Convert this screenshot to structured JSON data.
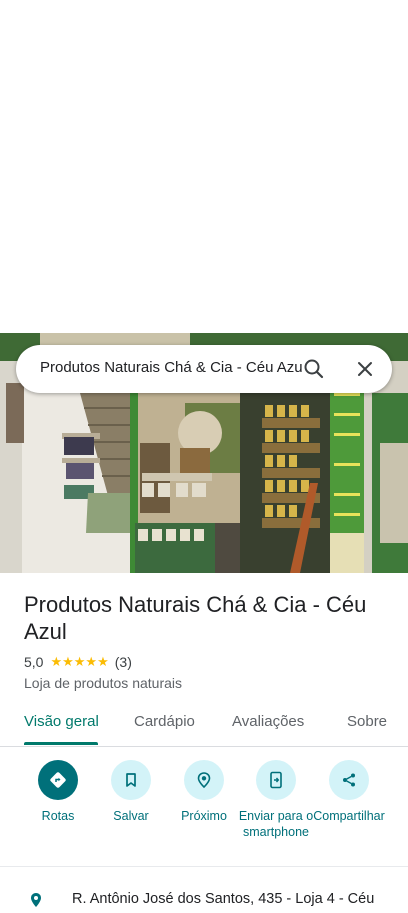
{
  "search": {
    "query": "Produtos Naturais Chá & Cia - Céu Azul"
  },
  "place": {
    "name": "Produtos Naturais Chá & Cia - Céu Azul",
    "rating": "5,0",
    "stars": "★★★★★",
    "review_count": "(3)",
    "category": "Loja de produtos naturais",
    "address": "R. Antônio José dos Santos, 435 - Loja 4 - Céu"
  },
  "tabs": [
    {
      "label": "Visão geral",
      "active": true
    },
    {
      "label": "Cardápio"
    },
    {
      "label": "Avaliações"
    },
    {
      "label": "Sobre"
    }
  ],
  "actions": [
    {
      "label": "Rotas",
      "icon": "directions-icon"
    },
    {
      "label": "Salvar",
      "icon": "bookmark-icon"
    },
    {
      "label": "Próximo",
      "icon": "nearby-icon"
    },
    {
      "label": "Enviar para o smartphone",
      "icon": "send-to-phone-icon"
    },
    {
      "label": "Compartilhar",
      "icon": "share-icon"
    }
  ],
  "colors": {
    "accent": "#00707a",
    "accent_light": "#d3f3f8",
    "star": "#fbbc04"
  }
}
